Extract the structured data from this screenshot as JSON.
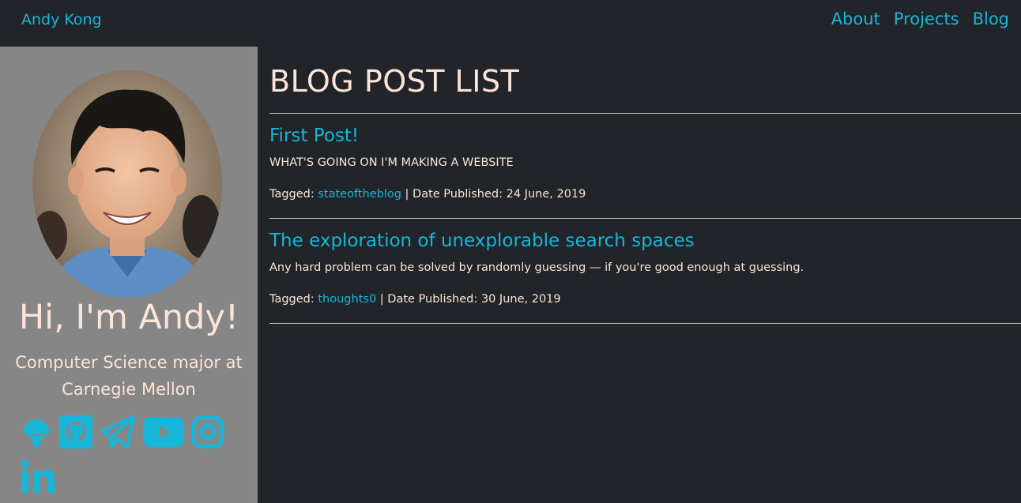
{
  "navbar": {
    "brand": "Andy Kong",
    "links": [
      "About",
      "Projects",
      "Blog"
    ]
  },
  "sidebar": {
    "greeting": "Hi, I'm Andy!",
    "tagline": "Computer Science major at Carnegie Mellon",
    "social_icons": [
      "ice-cream-icon",
      "github-icon",
      "telegram-icon",
      "youtube-icon",
      "instagram-icon",
      "linkedin-icon"
    ]
  },
  "main": {
    "title": "BLOG POST LIST",
    "posts": [
      {
        "title": "First Post!",
        "excerpt": "WHAT'S GOING ON I'M MAKING A WEBSITE",
        "tagged_label": "Tagged:",
        "tag": "stateoftheblog",
        "date_label": "| Date Published:",
        "date": "24 June, 2019"
      },
      {
        "title": "The exploration of unexplorable search spaces",
        "excerpt": "Any hard problem can be solved by randomly guessing — if you're good enough at guessing.",
        "tagged_label": "Tagged:",
        "tag": "thoughts0",
        "date_label": "| Date Published:",
        "date": "30 June, 2019"
      }
    ]
  },
  "colors": {
    "background": "#212529",
    "sidebar": "#868686",
    "accent": "#17b6d8",
    "text": "#fce4d6"
  }
}
